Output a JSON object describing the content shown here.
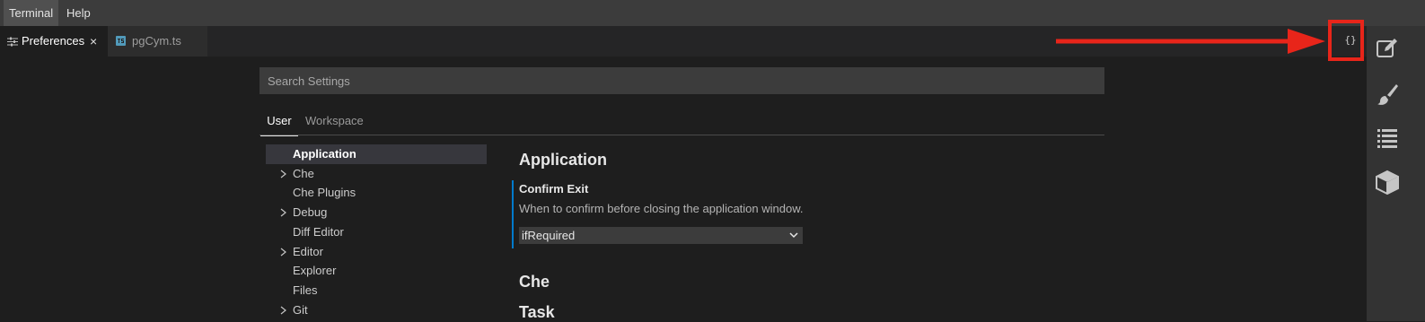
{
  "menubar": {
    "items": [
      "Terminal",
      "Help"
    ]
  },
  "tabs": [
    {
      "label": "Preferences",
      "close": "×",
      "active": true
    },
    {
      "label": "pgCym.ts",
      "active": false
    }
  ],
  "toolbar": {
    "json_button_label": "{}"
  },
  "search": {
    "placeholder": "Search Settings",
    "value": ""
  },
  "scope_tabs": [
    "User",
    "Workspace"
  ],
  "tree": [
    {
      "label": "Application",
      "expandable": false,
      "selected": true
    },
    {
      "label": "Che",
      "expandable": true
    },
    {
      "label": "Che Plugins",
      "expandable": false
    },
    {
      "label": "Debug",
      "expandable": true
    },
    {
      "label": "Diff Editor",
      "expandable": false
    },
    {
      "label": "Editor",
      "expandable": true
    },
    {
      "label": "Explorer",
      "expandable": false
    },
    {
      "label": "Files",
      "expandable": false
    },
    {
      "label": "Git",
      "expandable": true
    }
  ],
  "content": {
    "sections": [
      "Application",
      "Che",
      "Task"
    ],
    "setting": {
      "title": "Confirm Exit",
      "description": "When to confirm before closing the application window.",
      "value": "ifRequired"
    }
  },
  "right_bar_icons": [
    "edit-icon",
    "paint-brush-icon",
    "list-icon",
    "cube-icon"
  ],
  "colors": {
    "accent": "#007acc",
    "annotation": "#e8251a"
  }
}
